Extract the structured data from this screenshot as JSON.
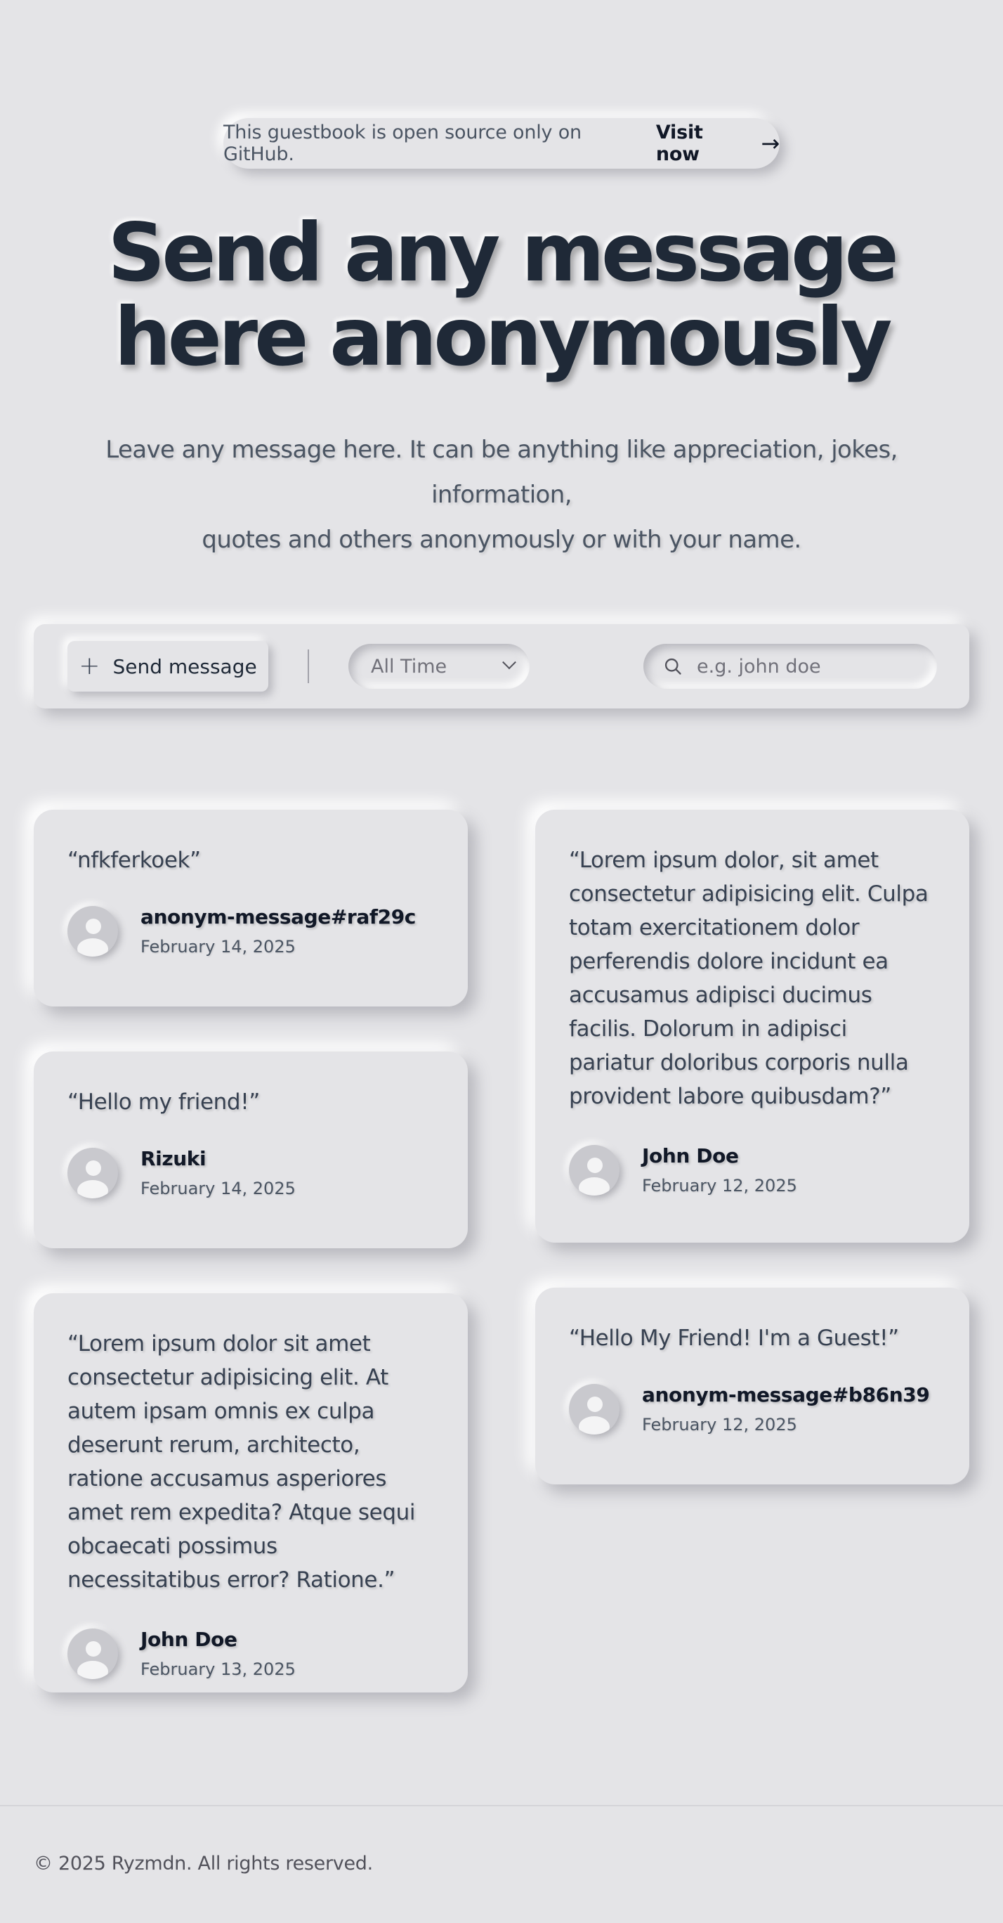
{
  "banner": {
    "text": "This guestbook is open source only on GitHub.",
    "link_label": "Visit now",
    "arrow": "→"
  },
  "hero": {
    "title_line1": "Send any message",
    "title_line2": "here anonymously",
    "subtitle_line1": "Leave any message here. It can be anything like appreciation, jokes, information,",
    "subtitle_line2": "quotes and others anonymously or with your name."
  },
  "toolbar": {
    "send_label": "Send message",
    "send_icon": "plus-icon",
    "filter": {
      "selected": "All Time",
      "icon": "chevron-down-icon"
    },
    "search": {
      "placeholder": "e.g. john doe",
      "value": "",
      "icon": "search-icon"
    }
  },
  "messages": [
    {
      "text": "“nfkferkoek”",
      "name": "anonym-message#raf29c",
      "date": "February 14, 2025"
    },
    {
      "text": "“Hello my friend!”",
      "name": "Rizuki",
      "date": "February 14, 2025"
    },
    {
      "text": "“Lorem ipsum dolor sit amet consectetur adipisicing elit. At autem ipsam omnis ex culpa deserunt rerum, architecto, ratione accusamus asperiores amet rem expedita? Atque sequi obcaecati possimus necessitatibus error? Ratione.”",
      "name": "John Doe",
      "date": "February 13, 2025"
    },
    {
      "text": "“Lorem ipsum dolor, sit amet consectetur adipisicing elit. Culpa totam exercitationem dolor perferendis dolore incidunt ea accusamus adipisci ducimus facilis. Dolorum in adipisci pariatur doloribus corporis nulla provident labore quibusdam?”",
      "name": "John Doe",
      "date": "February 12, 2025"
    },
    {
      "text": "“Hello My Friend! I'm a Guest!”",
      "name": "anonym-message#b86n39",
      "date": "February 12, 2025"
    }
  ],
  "footer": {
    "copyright": "© 2025 Ryzmdn. All rights reserved."
  }
}
